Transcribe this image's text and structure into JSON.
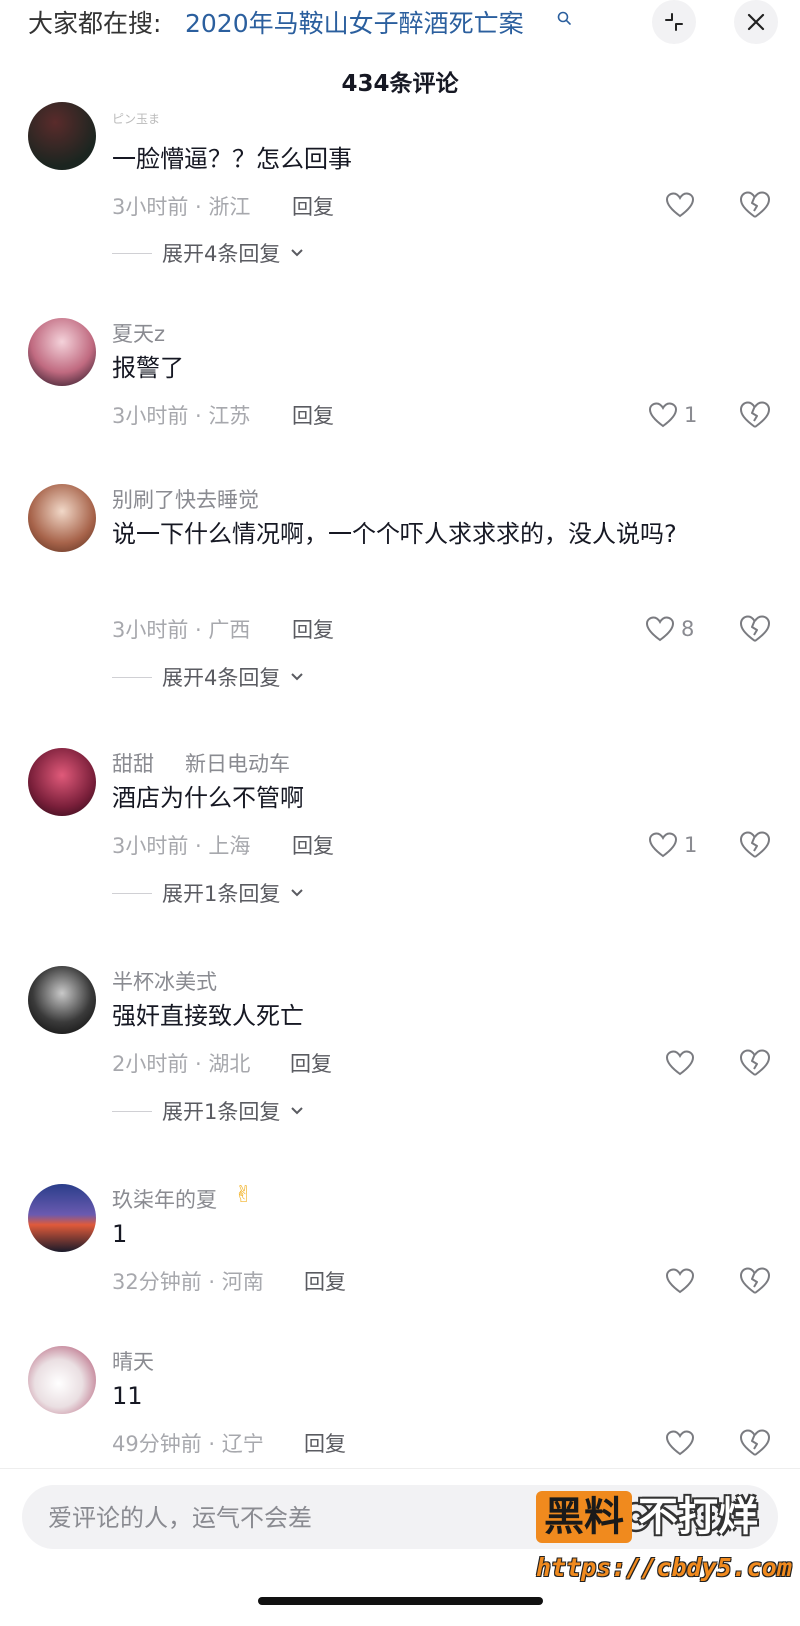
{
  "header": {
    "search_prefix": "大家都在搜:",
    "search_keyword": "2020年马鞍山女子醉酒死亡案",
    "comment_count_title": "434条评论"
  },
  "comments": [
    {
      "username": "ピン玉ま",
      "text": "一脸懵逼？？怎么回事",
      "time_location": "3小时前 · 浙江",
      "reply_label": "回复",
      "like_count": "",
      "expand_label": "展开4条回复"
    },
    {
      "username": "夏天z",
      "text": "报警了",
      "time_location": "3小时前 · 江苏",
      "reply_label": "回复",
      "like_count": "1",
      "expand_label": ""
    },
    {
      "username": "别刷了快去睡觉",
      "text": "说一下什么情况啊，一个个吓人求求求的，没人说吗?",
      "time_location": "3小时前 · 广西",
      "reply_label": "回复",
      "like_count": "8",
      "expand_label": "展开4条回复"
    },
    {
      "username": "甜甜",
      "username_tag": "新日电动车",
      "text": "酒店为什么不管啊",
      "time_location": "3小时前 · 上海",
      "reply_label": "回复",
      "like_count": "1",
      "expand_label": "展开1条回复"
    },
    {
      "username": "半杯冰美式",
      "text": "强奸直接致人死亡",
      "time_location": "2小时前 · 湖北",
      "reply_label": "回复",
      "like_count": "",
      "expand_label": "展开1条回复"
    },
    {
      "username": "玖柒年的夏",
      "username_emoji": "✌",
      "text": "1",
      "time_location": "32分钟前 · 河南",
      "reply_label": "回复",
      "like_count": "",
      "expand_label": ""
    },
    {
      "username": "晴天",
      "text": "11",
      "time_location": "49分钟前 · 辽宁",
      "reply_label": "回复",
      "like_count": "",
      "expand_label": ""
    }
  ],
  "input": {
    "placeholder": "爱评论的人，运气不会差"
  },
  "watermark": {
    "badge": "黑料",
    "text": "不打烊",
    "url": "https://cbdy5.com"
  },
  "colors": {
    "keyword_link": "#2b5f9e",
    "secondary_text": "#8a8b91",
    "watermark_orange": "#f08a1e"
  }
}
